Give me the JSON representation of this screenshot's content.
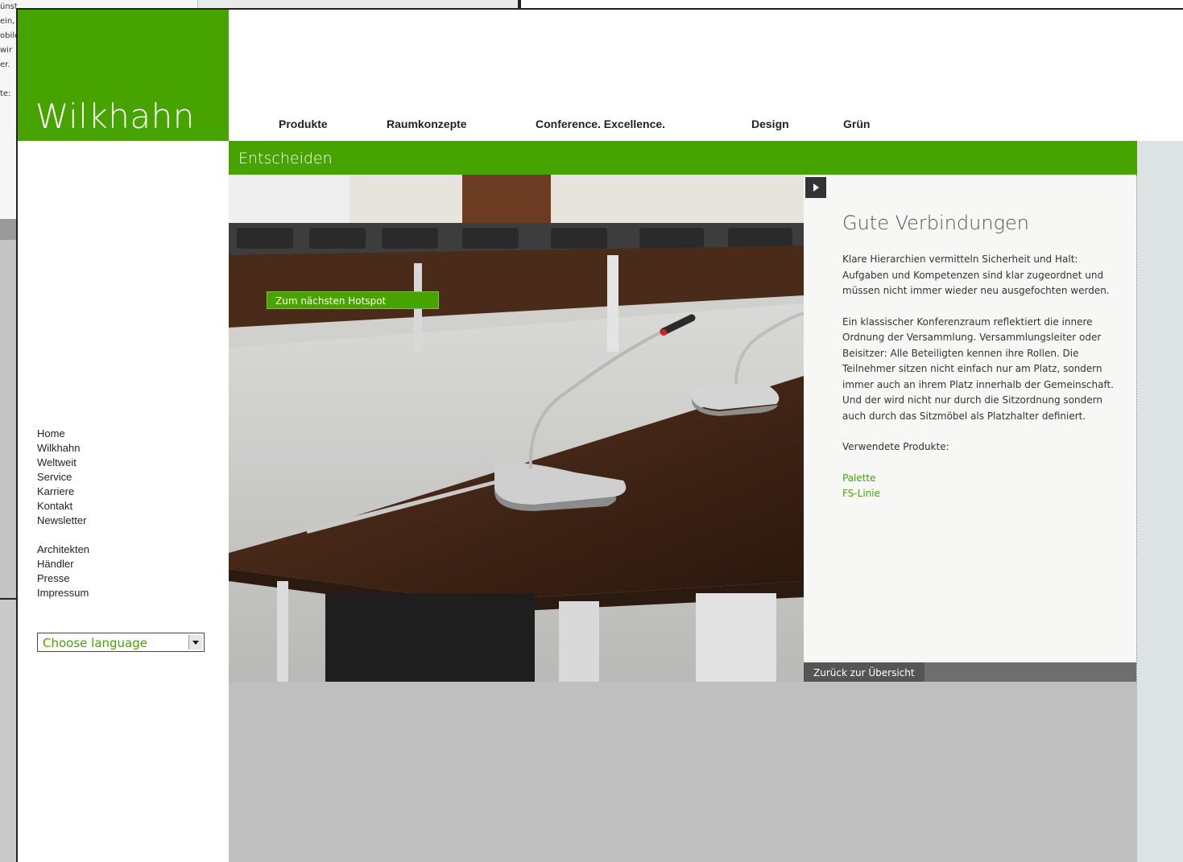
{
  "brand": {
    "logo_text": "Wilkhahn",
    "accent_color": "#47a400"
  },
  "topnav": {
    "items": [
      {
        "label": "Produkte"
      },
      {
        "label": "Raumkonzepte"
      },
      {
        "label": "Conference. Excellence."
      },
      {
        "label": "Design"
      },
      {
        "label": "Grün"
      }
    ]
  },
  "section": {
    "title": "Entscheiden"
  },
  "hotspot": {
    "button_label": "Zum nächsten Hotspot"
  },
  "info": {
    "title": "Gute Verbindungen",
    "paragraph1": "Klare Hierarchien vermitteln Sicherheit und Halt: Aufgaben und Kompetenzen sind klar zugeordnet und müssen nicht immer wieder neu ausgefochten werden.",
    "paragraph2": "Ein klassischer Konferenzraum reflektiert die innere Ordnung der Versammlung. Versammlungsleiter oder Beisitzer: Alle Beteiligten kennen ihre Rollen. Die Teilnehmer sitzen nicht einfach nur am Platz, sondern immer auch an ihrem Platz innerhalb der Gemeinschaft. Und der wird nicht nur durch die Sitzordnung sondern auch durch das Sitzmöbel als Platzhalter definiert.",
    "products_label": "Verwendete Produkte:",
    "products": [
      "Palette",
      "FS-Linie"
    ],
    "back_label": "Zurück zur Übersicht"
  },
  "sidenav": {
    "group1": [
      "Home",
      "Wilkhahn",
      "Weltweit",
      "Service",
      "Karriere",
      "Kontakt",
      "Newsletter"
    ],
    "group2": [
      "Architekten",
      "Händler",
      "Presse",
      "Impressum"
    ]
  },
  "language": {
    "selected": "Choose language"
  },
  "background_window": {
    "text_fragments": [
      "ünst",
      "ein,",
      "obile",
      "wir",
      "er.",
      "te:"
    ]
  }
}
